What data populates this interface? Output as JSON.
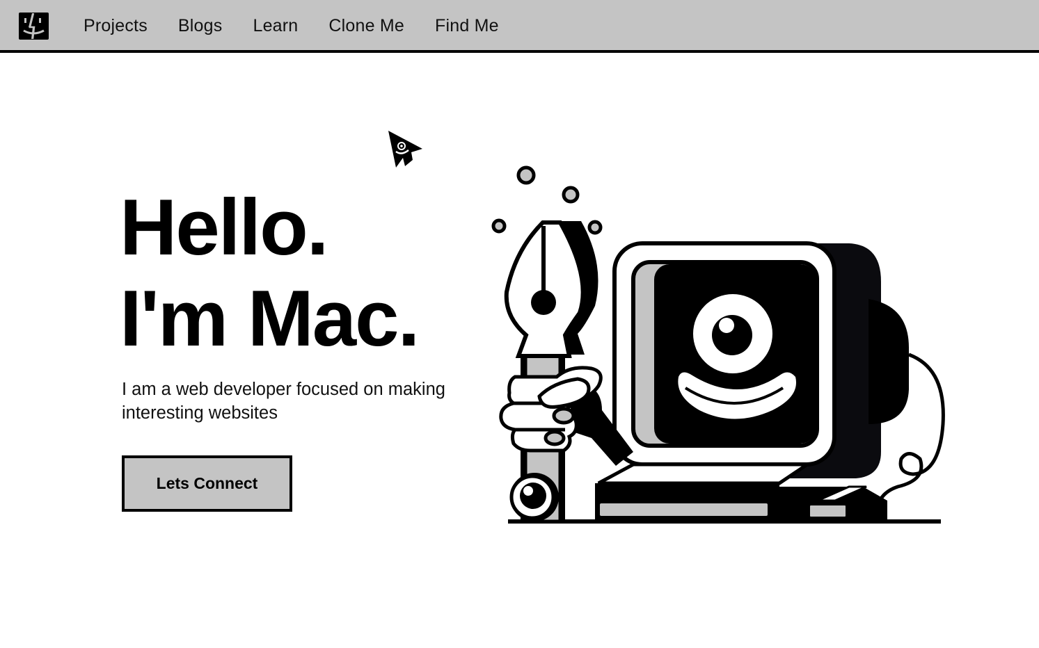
{
  "nav": {
    "logo_icon": "finder-face-icon",
    "links": [
      "Projects",
      "Blogs",
      "Learn",
      "Clone Me",
      "Find Me"
    ]
  },
  "hero": {
    "title_line1": "Hello.",
    "title_line2": "I'm Mac.",
    "subtitle": "I am a web developer focused on making interesting websites",
    "cta_label": "Lets Connect",
    "cursor_icon": "smiley-pointer-icon",
    "illustration": "computer-and-pen-illustration"
  },
  "colors": {
    "nav_bg": "#c4c4c4",
    "accent": "#000000",
    "button_bg": "#c4c4c4",
    "page_bg": "#ffffff"
  }
}
